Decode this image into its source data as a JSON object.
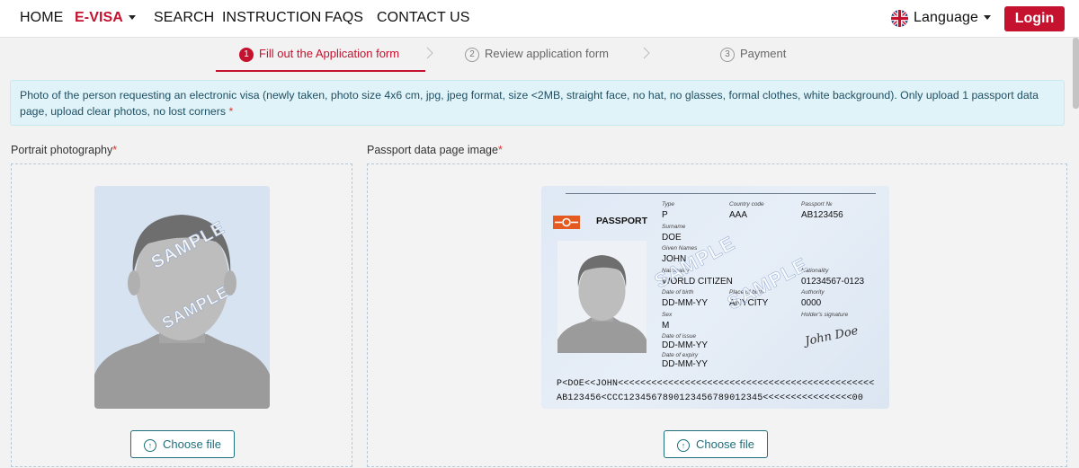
{
  "nav": {
    "items": [
      {
        "label": "HOME"
      },
      {
        "label": "E-VISA"
      },
      {
        "label": "SEARCH"
      },
      {
        "label": "INSTRUCTION"
      },
      {
        "label": "FAQS"
      },
      {
        "label": "CONTACT US"
      }
    ],
    "language_label": "Language",
    "login_label": "Login"
  },
  "steps": [
    {
      "num": "1",
      "label": "Fill out the Application form"
    },
    {
      "num": "2",
      "label": "Review application form"
    },
    {
      "num": "3",
      "label": "Payment"
    }
  ],
  "notice": {
    "text": "Photo of the person requesting an electronic visa (newly taken, photo size 4x6 cm, jpg, jpeg format, size <2MB, straight face, no hat, no glasses, formal clothes, white background). Only upload 1 passport data page, upload clear photos, no lost corners",
    "required_mark": "*"
  },
  "portrait": {
    "label": "Portrait photography",
    "required_mark": "*",
    "watermark": "SAMPLE",
    "button_label": "Choose file"
  },
  "passport": {
    "label": "Passport data page image",
    "required_mark": "*",
    "button_label": "Choose file",
    "watermark": "SAMPLE",
    "title": "PASSPORT",
    "type_label": "Type",
    "type": "P",
    "country_code_label": "Country code",
    "country_code": "AAA",
    "passport_no_label": "Passport №",
    "passport_no": "AB123456",
    "surname_label": "Surname",
    "surname": "DOE",
    "given_names_label": "Given Names",
    "given_names": "JOHN",
    "nationality_label": "Nationality",
    "nationality": "WORLD CITIZEN",
    "personal_no_label": "Nationality",
    "personal_no": "01234567-0123",
    "dob_label": "Date of birth",
    "dob": "DD-MM-YY",
    "pob_label": "Place of birth",
    "pob": "ANYCITY",
    "authority_label": "Authority",
    "authority": "0000",
    "sex_label": "Sex",
    "sex": "M",
    "signature_label": "Holder's signature",
    "signature": "John Doe",
    "issue_label": "Date of issue",
    "issue": "DD-MM-YY",
    "expiry_label": "Date of expiry",
    "expiry": "DD-MM-YY",
    "mrz1": "P<DOE<<JOHN<<<<<<<<<<<<<<<<<<<<<<<<<<<<<<<<<<<<<<<<<<<<<<",
    "mrz2": "AB123456<CCC1234567890123456789012345<<<<<<<<<<<<<<<<00"
  },
  "colors": {
    "brand": "#c4122f",
    "notice_bg": "#dff3f8",
    "accent": "#1f6f7c"
  }
}
